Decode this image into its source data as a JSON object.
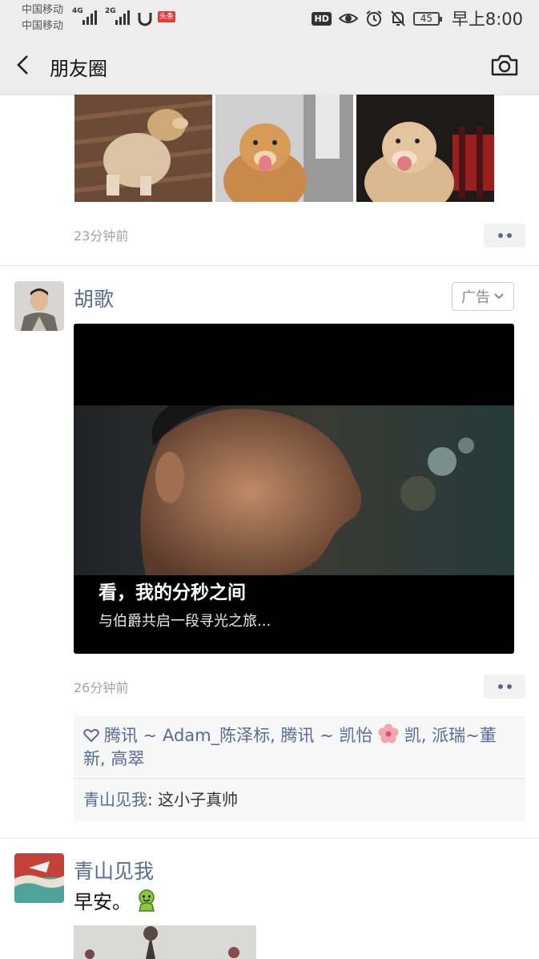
{
  "status_bar": {
    "carrier_1": "中国移动",
    "carrier_2": "中国移动",
    "network_1": "4G",
    "network_2": "2G",
    "app_badge": "头条",
    "hd": "HD",
    "battery": "45",
    "time": "早上8:00"
  },
  "nav": {
    "title": "朋友圈",
    "back_icon": "chevron-left-icon",
    "camera_icon": "camera-icon"
  },
  "posts": [
    {
      "time": "23分钟前"
    },
    {
      "author": "胡歌",
      "ad_label": "广告",
      "video_title": "看，我的分秒之间",
      "video_subtitle": "与伯爵共启一段寻光之旅...",
      "time": "26分钟前",
      "likes": "腾讯 ~ Adam_陈泽标, 腾讯 ~ 凯怡 凯, 派瑞~董新, 高翠",
      "likes_part1": "腾讯 ~ Adam_陈泽标, 腾讯 ~ 凯怡",
      "likes_part2": "凯, 派瑞~董新, 高翠",
      "comment_author": "青山见我",
      "comment_sep": ": ",
      "comment_text": "这小子真帅"
    },
    {
      "author": "青山见我",
      "text": "早安。"
    }
  ]
}
